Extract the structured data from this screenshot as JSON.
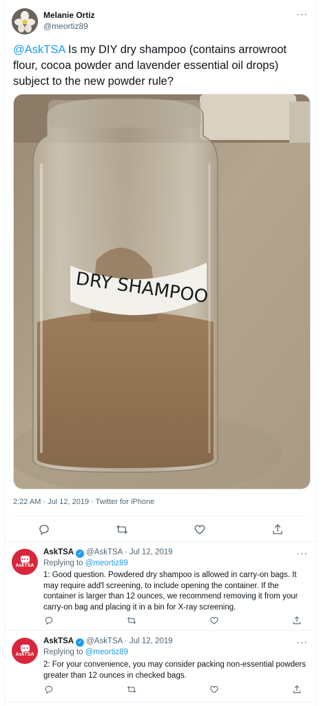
{
  "main_tweet": {
    "author_name": "Melanie Ortiz",
    "author_handle": "@meortiz89",
    "more_label": "···",
    "mention": "@AskTSA",
    "text": " Is my DIY dry shampoo (contains arrowroot flour, cocoa powder and lavender essential oil drops) subject to the new powder rule?",
    "photo_label": "DRY SHAMPOO",
    "timestamp": "2:22 AM · Jul 12, 2019 · Twitter for iPhone",
    "actions": [
      "reply-icon",
      "retweet-icon",
      "like-icon",
      "share-icon"
    ]
  },
  "replies": [
    {
      "avatar_label": "AskTSA",
      "name": "AskTSA",
      "verified_mark": "✓",
      "handle_date": "@AskTSA · Jul 12, 2019",
      "more_label": "···",
      "replying_prefix": "Replying to ",
      "replying_handle": "@meortiz89",
      "text": "1: Good question. Powdered dry shampoo is allowed in carry-on bags. It may require add'l screening, to include opening the container. If the container is larger than 12 ounces, we recommend removing it from your carry-on bag and placing it in a bin for X-ray screening."
    },
    {
      "avatar_label": "AskTSA",
      "name": "AskTSA",
      "verified_mark": "✓",
      "handle_date": "@AskTSA · Jul 12, 2019",
      "more_label": "···",
      "replying_prefix": "Replying to ",
      "replying_handle": "@meortiz89",
      "text": "2: For your convenience, you may consider packing non-essential powders greater than 12 ounces in checked bags."
    }
  ],
  "colors": {
    "link": "#1d9bf0",
    "secondary_text": "#536471",
    "asktsa_avatar": "#d8263d"
  }
}
